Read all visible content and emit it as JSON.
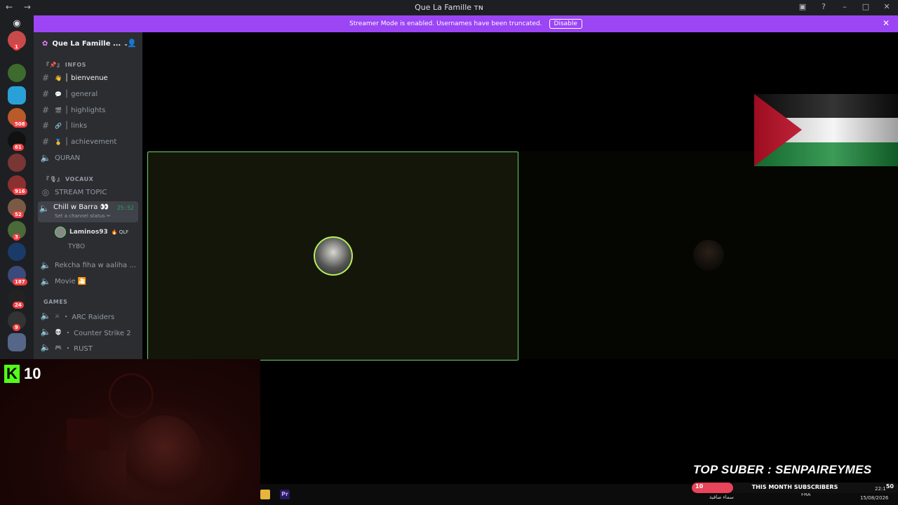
{
  "window": {
    "title": "Que La Famille ᴛɴ",
    "nav_back": "←",
    "nav_forward": "→"
  },
  "banner": {
    "text": "Streamer Mode is enabled. Usernames have been truncated.",
    "button": "Disable"
  },
  "guilds": [
    {
      "badge": "1",
      "color": "#c94a4a"
    },
    {
      "badge": "",
      "color": "#3d6b2e"
    },
    {
      "badge": "",
      "color": "#2aa0d8"
    },
    {
      "badge": "508",
      "color": "#b85a2a"
    },
    {
      "badge": "61",
      "color": "#111111"
    },
    {
      "badge": "",
      "color": "#7a3535"
    },
    {
      "badge": "916",
      "color": "#8a3030"
    },
    {
      "badge": "52",
      "color": "#7a5a44"
    },
    {
      "badge": "3",
      "color": "#4a6a3a"
    },
    {
      "badge": "",
      "color": "#1a3a6a"
    },
    {
      "badge": "187",
      "color": "#3a4a7a"
    },
    {
      "badge": "24",
      "color": "#222222"
    },
    {
      "badge": "9",
      "color": "#333333"
    },
    {
      "badge": "",
      "color": "#556688"
    }
  ],
  "server": {
    "name": "Que La Famille ..."
  },
  "categories": {
    "infos": "『📌』 INFOS",
    "vocaux": "『🎙』 VOCAUX",
    "games": "GAMES"
  },
  "channels": {
    "bienvenue": {
      "emoji": "👋",
      "label": "│ bienvenue"
    },
    "general": {
      "emoji": "💬",
      "label": "│ general"
    },
    "highlights": {
      "emoji": "🎬",
      "label": "│ highlights"
    },
    "links": {
      "emoji": "🔗",
      "label": "│ links"
    },
    "achievement": {
      "emoji": "🥇",
      "label": "│ achievement"
    },
    "quran": {
      "label": "QURAN"
    },
    "stream_topic": {
      "label": "STREAM TOPIC"
    },
    "chill": {
      "label": "Chill w Barra 👀",
      "timer": "25:52",
      "status": "Set a channel status ✏"
    },
    "rekcha": {
      "label": "Rekcha fiha w aaliha ..."
    },
    "movie": {
      "label": "Movie 🎦"
    },
    "arc": {
      "emoji": "⚔",
      "label": "・ ARC Raiders"
    },
    "cs2": {
      "emoji": "💀",
      "label": "・ Counter Strike 2"
    },
    "rust": {
      "emoji": "🎮",
      "label": "・ RUST"
    }
  },
  "members": [
    {
      "name": "Laminos93",
      "tag": "🔥 QLF"
    },
    {
      "name": "TYBO",
      "tag": ""
    }
  ],
  "overlay": {
    "kick_logo": "K",
    "kick_count": "10",
    "top_sub": "TOP SUBER : SENPAIREYMES"
  },
  "sub_bar": {
    "current": "10",
    "label": "THIS MONTH SUBSCRIBERS",
    "goal": "50",
    "progress": 0.2
  },
  "tray": {
    "weather": "سماء صافية",
    "lang": "FRA",
    "time": "22:1",
    "date": "15/08/2026"
  },
  "colors": {
    "accent": "#9b45f5",
    "speaking": "#6bd16b",
    "kick": "#53fc18",
    "flag_red": "#d0102a",
    "flag_green": "#1a8a3a"
  }
}
